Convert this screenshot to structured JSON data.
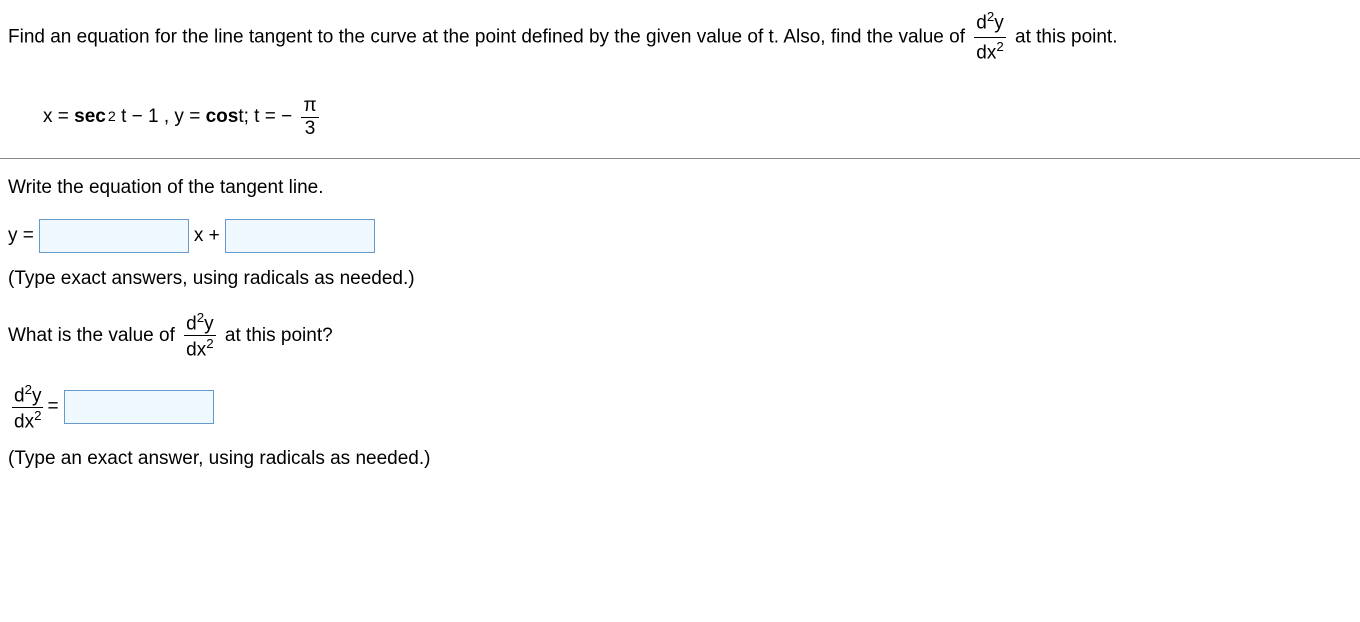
{
  "statement": {
    "part1": "Find an equation for the line tangent to the curve at the point defined by the given value of t. Also, find the value of ",
    "part2": " at this point."
  },
  "equation": {
    "x_label": "x =",
    "sec_label": "sec",
    "t_minus1": "t − 1",
    "comma_y": ", y =",
    "cos_label": "cos",
    "t_label": " t;",
    "t_eq": "t = −"
  },
  "pi": "π",
  "three": "3",
  "two": "2",
  "d2y": "d",
  "y_char": "y",
  "dx_char": "dx",
  "prompt1": "Write the equation of the tangent line.",
  "tangent_line": {
    "y_eq": "y =",
    "x_plus": "x +"
  },
  "hint1": "(Type exact answers, using radicals as needed.)",
  "prompt2_a": "What is the value of ",
  "prompt2_b": " at this point?",
  "equals": " =",
  "hint2": "(Type an exact answer, using radicals as needed.)"
}
